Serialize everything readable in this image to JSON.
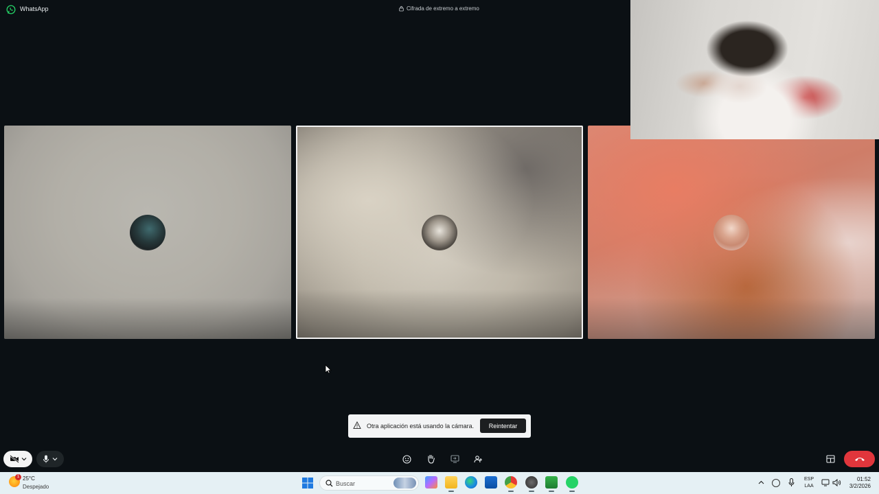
{
  "window": {
    "app_title": "WhatsApp",
    "encryption_label": "Cifrada de extremo a extremo"
  },
  "call": {
    "participants": [
      {
        "avatar": "participant-avatar-1"
      },
      {
        "avatar": "participant-avatar-2",
        "active_speaker": true
      },
      {
        "avatar": "participant-avatar-3"
      }
    ],
    "toast": {
      "message": "Otra aplicación está usando la cámara.",
      "retry_label": "Reintentar"
    },
    "controls": {
      "camera_icon": "camera-off-icon",
      "mic_icon": "microphone-icon",
      "center_icons": [
        "emoji-icon",
        "raise-hand-icon",
        "share-screen-icon",
        "participants-icon"
      ],
      "layout_icon": "layout-icon",
      "end_call_icon": "phone-hangup-icon"
    },
    "colors": {
      "end_call": "#e1363c",
      "background": "#0b1014"
    }
  },
  "taskbar": {
    "weather": {
      "badge": "1",
      "temperature": "25°C",
      "condition": "Despejado"
    },
    "search_placeholder": "Buscar",
    "apps": [
      "windows-start-icon",
      "copilot-icon",
      "file-explorer-icon",
      "edge-icon",
      "store-icon",
      "chrome-icon",
      "app-icon",
      "xbox-icon",
      "whatsapp-icon"
    ],
    "tray": {
      "language_line1": "ESP",
      "language_line2": "LAA",
      "time": "01:52",
      "date": "3/2/2026"
    }
  }
}
